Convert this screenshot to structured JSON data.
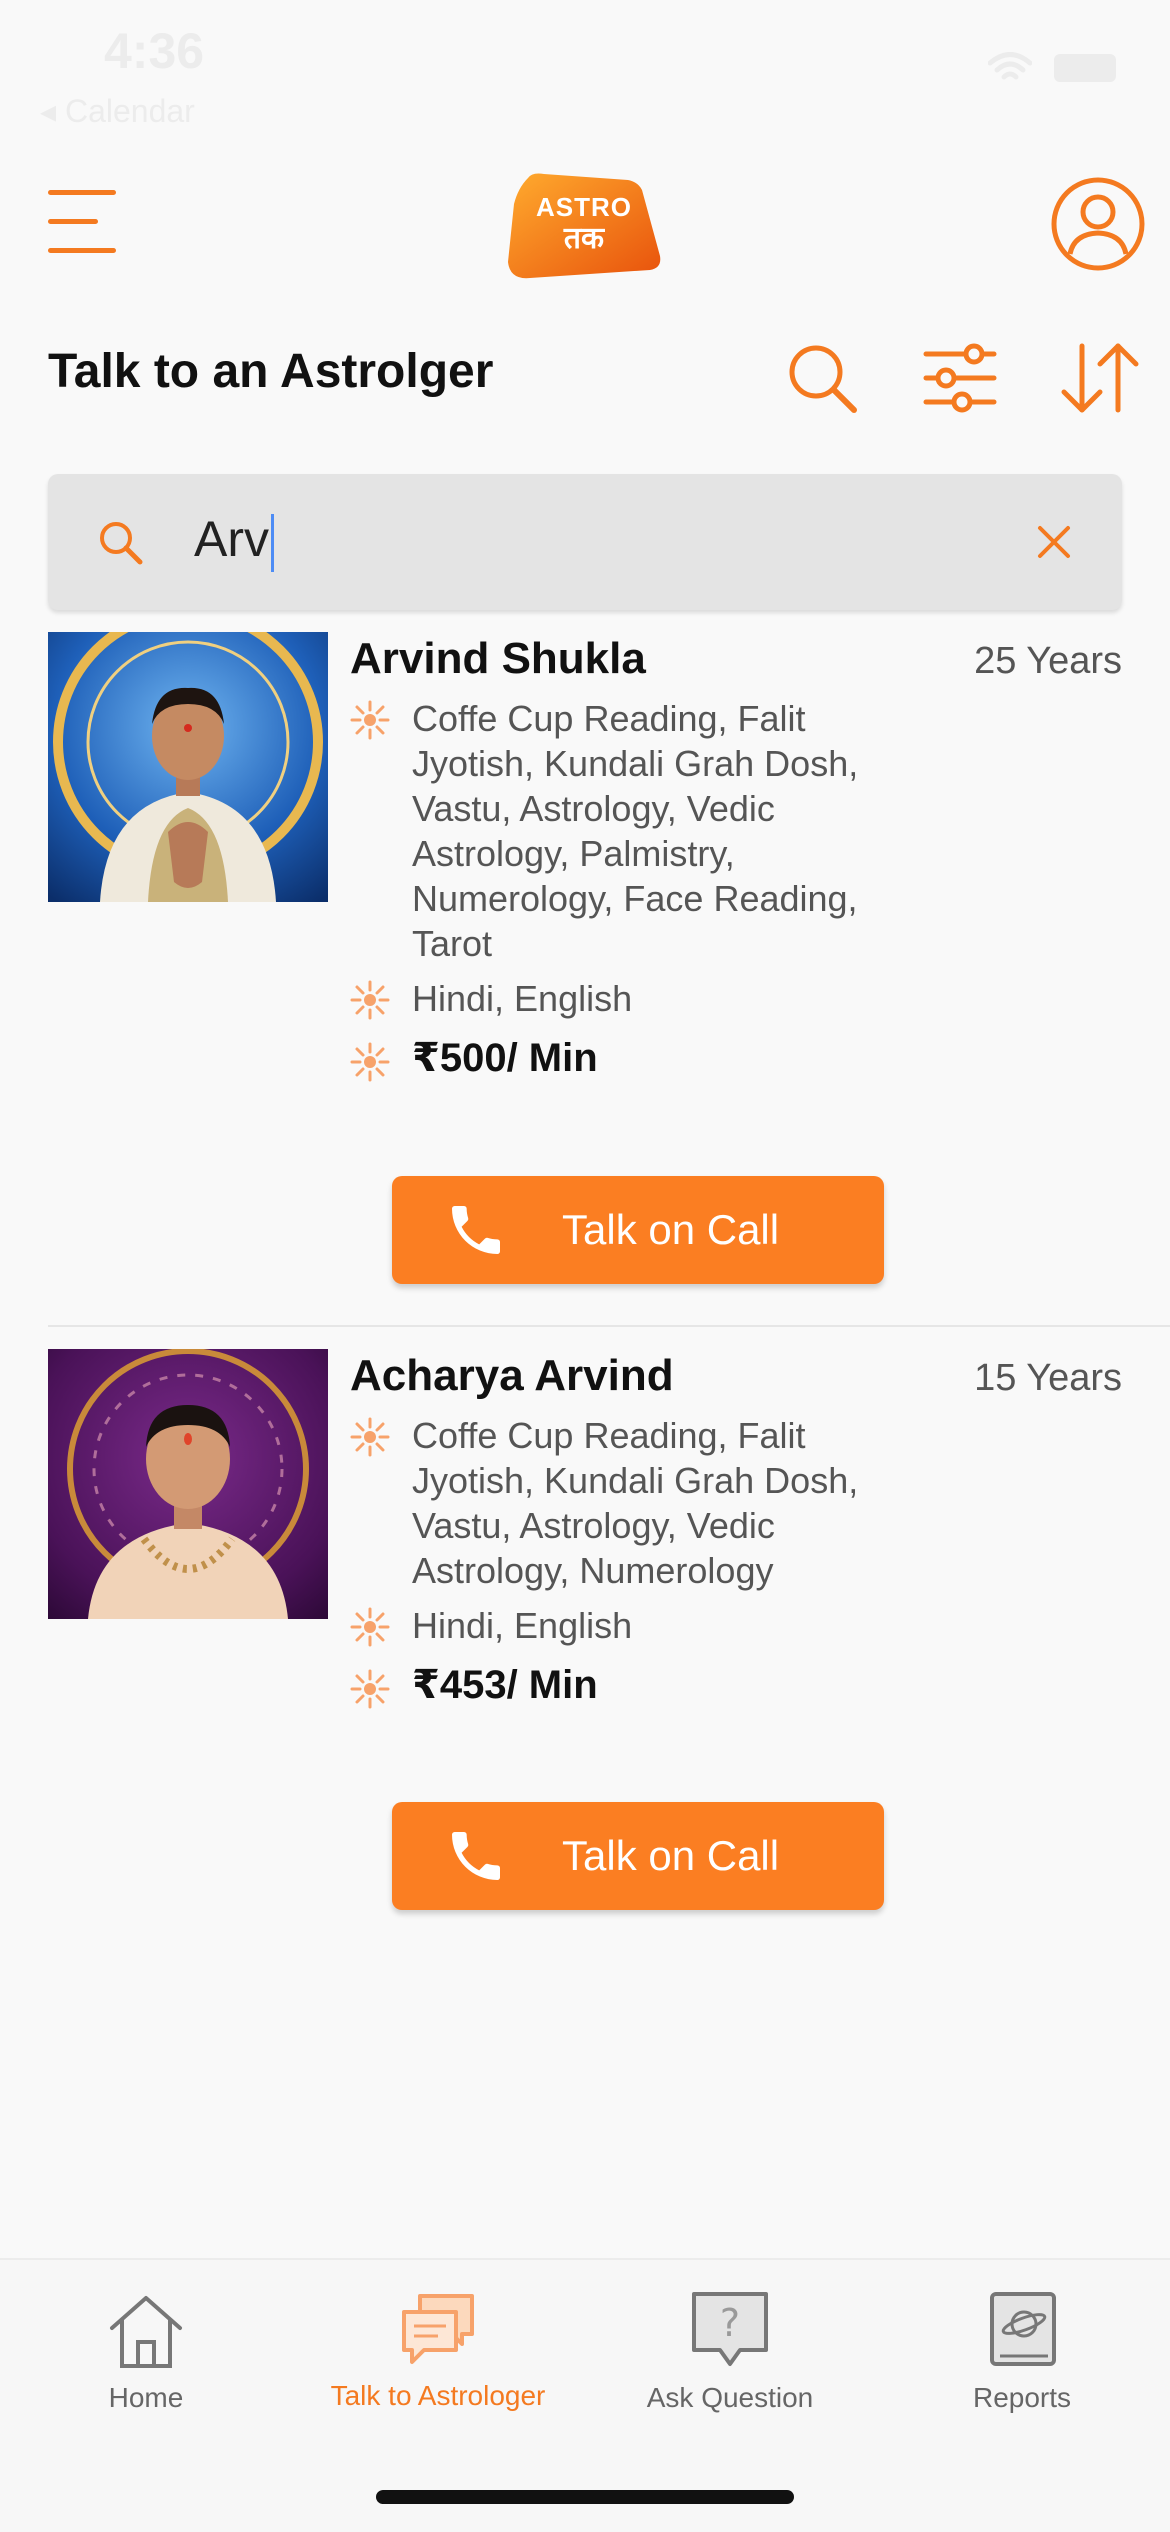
{
  "status_bar": {
    "time": "4:36",
    "back_label": "Calendar"
  },
  "header": {
    "logo_line1": "ASTRO",
    "logo_line2": "तक"
  },
  "page": {
    "title": "Talk to an Astrolger"
  },
  "search": {
    "value": "Arv",
    "placeholder": ""
  },
  "astrologers": [
    {
      "name": "Arvind Shukla",
      "experience": "25 Years",
      "skills": [
        "Coffe Cup Reading, Falit",
        "Jyotish, Kundali Grah Dosh,",
        "Vastu, Astrology, Vedic",
        "Astrology, Palmistry,",
        "Numerology, Face Reading,",
        "Tarot"
      ],
      "languages": "Hindi, English",
      "price": "₹500/ Min",
      "call_label": "Talk on Call"
    },
    {
      "name": "Acharya Arvind",
      "experience": "15 Years",
      "skills": [
        "Coffe Cup Reading, Falit",
        "Jyotish, Kundali Grah Dosh,",
        "Vastu, Astrology, Vedic",
        "Astrology, Numerology"
      ],
      "languages": "Hindi, English",
      "price": "₹453/ Min",
      "call_label": "Talk on Call"
    }
  ],
  "tabs": [
    {
      "label": "Home",
      "icon": "home-icon",
      "active": false
    },
    {
      "label": "Talk to Astrologer",
      "icon": "chat-icon",
      "active": true
    },
    {
      "label": "Ask Question",
      "icon": "question-icon",
      "active": false
    },
    {
      "label": "Reports",
      "icon": "book-icon",
      "active": false
    }
  ],
  "colors": {
    "accent": "#f47a20",
    "button": "#fb7e22",
    "background": "#f9f9f9"
  }
}
